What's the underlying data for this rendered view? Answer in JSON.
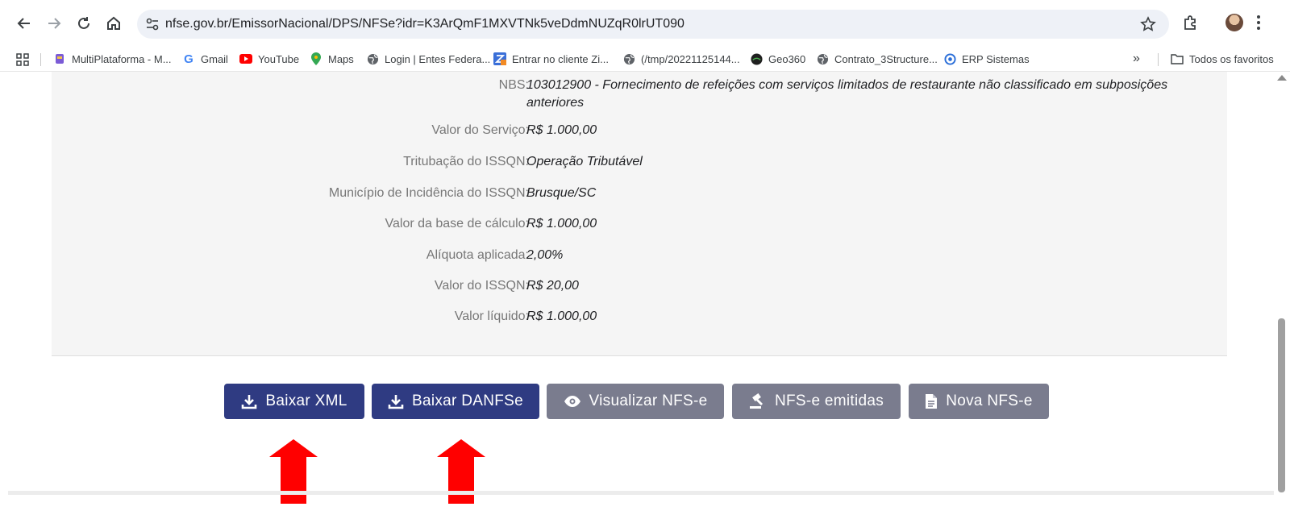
{
  "browser": {
    "url": "nfse.gov.br/EmissorNacional/DPS/NFSe?idr=K3ArQmF1MXVTNk5veDdmNUZqR0lrUT090"
  },
  "bookmarks": {
    "items": [
      {
        "label": "MultiPlataforma - M...",
        "icon": "multiplataforma-icon"
      },
      {
        "label": "Gmail",
        "icon": "google-icon"
      },
      {
        "label": "YouTube",
        "icon": "youtube-icon"
      },
      {
        "label": "Maps",
        "icon": "maps-pin-icon"
      },
      {
        "label": "Login | Entes Federa...",
        "icon": "globe-icon"
      },
      {
        "label": "Entrar no cliente Zi...",
        "icon": "zimbra-icon"
      },
      {
        "label": "(/tmp/20221125144...",
        "icon": "globe-icon"
      },
      {
        "label": "Geo360",
        "icon": "geo360-icon"
      },
      {
        "label": "Contrato_3Structure...",
        "icon": "globe-icon"
      },
      {
        "label": "ERP Sistemas",
        "icon": "erp-icon"
      }
    ],
    "overflow": "»",
    "all_bookmarks": "Todos os favoritos"
  },
  "details": {
    "rows": [
      {
        "label": "NBS:",
        "value": "103012900 - Fornecimento de refeições com serviços limitados de restaurante não classificado em subposições anteriores"
      },
      {
        "label": "Valor do Serviço:",
        "value": "R$ 1.000,00"
      },
      {
        "label": "Tritubação do ISSQN:",
        "value": "Operação Tributável"
      },
      {
        "label": "Município de Incidência do ISSQN:",
        "value": "Brusque/SC"
      },
      {
        "label": "Valor da base de cálculo:",
        "value": "R$ 1.000,00"
      },
      {
        "label": "Alíquota aplicada:",
        "value": "2,00%"
      },
      {
        "label": "Valor do ISSQN:",
        "value": "R$ 20,00"
      },
      {
        "label": "Valor líquido:",
        "value": "R$ 1.000,00"
      }
    ]
  },
  "actions": {
    "baixar_xml": "Baixar XML",
    "baixar_danfse": "Baixar DANFSe",
    "visualizar": "Visualizar NFS-e",
    "emitidas": "NFS-e emitidas",
    "nova": "Nova NFS-e"
  },
  "colors": {
    "primary_button": "#2f3b82",
    "secondary_button": "#7a7c8e",
    "annotation_arrow": "#ff0000"
  }
}
